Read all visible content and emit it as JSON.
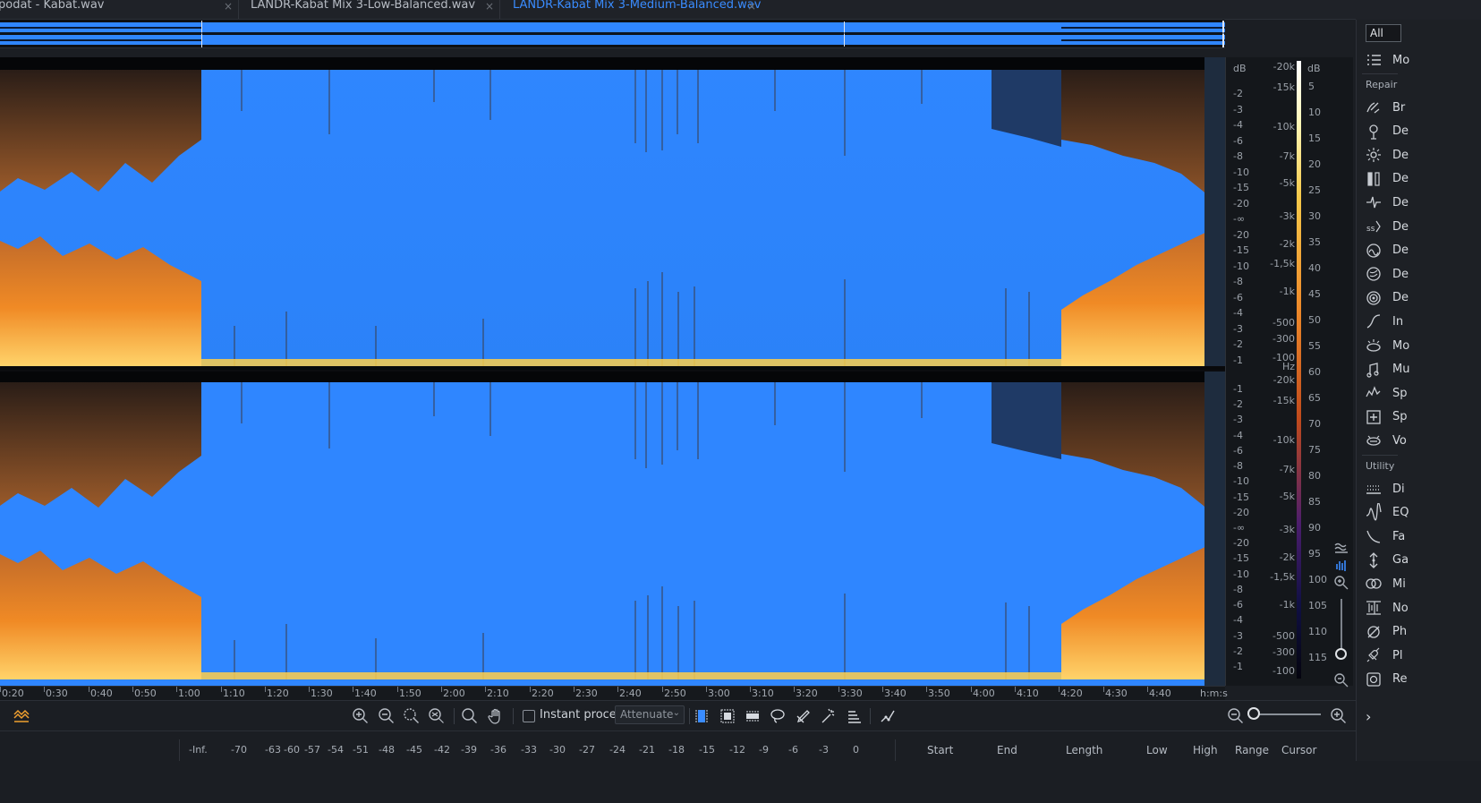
{
  "tabs": [
    {
      "label": "podat - Kabat.wav",
      "active": false
    },
    {
      "label": "LANDR-Kabat Mix 3-Low-Balanced.wav",
      "active": false
    },
    {
      "label": "LANDR-Kabat Mix 3-Medium-Balanced.wav",
      "active": true
    }
  ],
  "tab_close_glyph": "×",
  "ruler_db_header": "dB",
  "ruler_hz_unit": "Hz",
  "ruler_db_top": [
    "-2",
    "-3",
    "-4",
    "-6",
    "-8",
    "-10",
    "-15",
    "-20",
    "-∞",
    "-20",
    "-15",
    "-10",
    "-8",
    "-6",
    "-4",
    "-3",
    "-2",
    "-1"
  ],
  "ruler_db_bottom": [
    "-1",
    "-2",
    "-3",
    "-4",
    "-6",
    "-8",
    "-10",
    "-15",
    "-20",
    "-∞",
    "-20",
    "-15",
    "-10",
    "-8",
    "-6",
    "-4",
    "-3",
    "-2",
    "-1"
  ],
  "ruler_hz_top": [
    "-20k",
    "-15k",
    "-10k",
    "-7k",
    "-5k",
    "-3k",
    "-2k",
    "-1,5k",
    "-1k",
    "-500",
    "-300",
    "-100"
  ],
  "ruler_hz_bottom": [
    "-20k",
    "-15k",
    "-10k",
    "-7k",
    "-5k",
    "-3k",
    "-2k",
    "-1,5k",
    "-1k",
    "-500",
    "-300",
    "-100"
  ],
  "meter_header": "dB",
  "meter_labels": [
    "5",
    "10",
    "15",
    "20",
    "25",
    "30",
    "35",
    "40",
    "45",
    "50",
    "55",
    "60",
    "65",
    "70",
    "75",
    "80",
    "85",
    "90",
    "95",
    "100",
    "105",
    "110",
    "115"
  ],
  "timeline_labels": [
    "0:20",
    "0:30",
    "0:40",
    "0:50",
    "1:00",
    "1:10",
    "1:20",
    "1:30",
    "1:40",
    "1:50",
    "2:00",
    "2:10",
    "2:20",
    "2:30",
    "2:40",
    "2:50",
    "3:00",
    "3:10",
    "3:20",
    "3:30",
    "3:40",
    "3:50",
    "4:00",
    "4:10",
    "4:20",
    "4:30",
    "4:40"
  ],
  "timeline_unit": "h:m:s",
  "toolbar": {
    "instant_process_label": "Instant process",
    "mode_value": "Attenuate",
    "icons": [
      "zoom-in-icon",
      "zoom-out-icon",
      "zoom-selection-icon",
      "zoom-fit-icon",
      "magnify-icon",
      "hand-icon",
      "time-select-icon",
      "rect-select-icon",
      "freq-select-icon",
      "lasso-icon",
      "brush-icon",
      "magic-wand-icon",
      "harmonic-select-icon",
      "envelope-icon"
    ]
  },
  "status": {
    "meter_scale": [
      "-Inf.",
      "-70",
      "-63",
      "-60",
      "-57",
      "-54",
      "-51",
      "-48",
      "-45",
      "-42",
      "-39",
      "-36",
      "-33",
      "-30",
      "-27",
      "-24",
      "-21",
      "-18",
      "-15",
      "-12",
      "-9",
      "-6",
      "-3",
      "0"
    ],
    "headers": [
      "Start",
      "End",
      "Length",
      "Low",
      "High",
      "Range",
      "Cursor"
    ]
  },
  "module_panel": {
    "filter_value": "All",
    "list_label": "Mo",
    "section_repair": "Repair",
    "section_utility": "Utility",
    "repair_items": [
      {
        "icon": "breath-control-icon",
        "label": "Br"
      },
      {
        "icon": "de-bleed-icon",
        "label": "De"
      },
      {
        "icon": "de-click-icon",
        "label": "De"
      },
      {
        "icon": "de-clip-icon",
        "label": "De"
      },
      {
        "icon": "de-crackle-icon",
        "label": "De"
      },
      {
        "icon": "de-ess-icon",
        "label": "De"
      },
      {
        "icon": "de-hum-icon",
        "label": "De"
      },
      {
        "icon": "de-plosive-icon",
        "label": "De"
      },
      {
        "icon": "de-reverb-icon",
        "label": "De"
      },
      {
        "icon": "interpolate-icon",
        "label": "In"
      },
      {
        "icon": "mouth-declick-icon",
        "label": "Mo"
      },
      {
        "icon": "music-rebalance-icon",
        "label": "Mu"
      },
      {
        "icon": "spectral-denoise-icon",
        "label": "Sp"
      },
      {
        "icon": "spectral-repair-icon",
        "label": "Sp"
      },
      {
        "icon": "voice-denoise-icon",
        "label": "Vo"
      }
    ],
    "utility_items": [
      {
        "icon": "dither-icon",
        "label": "Di"
      },
      {
        "icon": "eq-icon",
        "label": "EQ"
      },
      {
        "icon": "fade-icon",
        "label": "Fa"
      },
      {
        "icon": "gain-icon",
        "label": "Ga"
      },
      {
        "icon": "mixing-icon",
        "label": "Mi"
      },
      {
        "icon": "normalize-icon",
        "label": "No"
      },
      {
        "icon": "phase-icon",
        "label": "Ph"
      },
      {
        "icon": "plugin-icon",
        "label": "Pl"
      },
      {
        "icon": "resample-icon",
        "label": "Re"
      }
    ]
  },
  "colors": {
    "waveform_blue": "#2f86ff",
    "spectral_orange": "#f08a25",
    "spectral_hot": "#ffe27a",
    "active_tab": "#3a8cff"
  }
}
